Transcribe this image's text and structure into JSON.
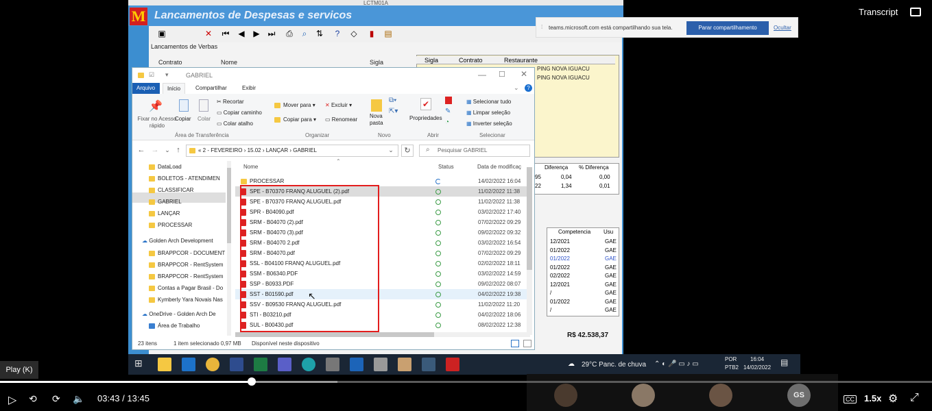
{
  "video": {
    "transcript_label": "Transcript",
    "play_tooltip": "Play (K)",
    "current_time": "03:43",
    "time_separator": "/",
    "duration": "13:45",
    "speed": "1.5x",
    "cc_label": "CC",
    "progress_fraction": 0.27
  },
  "share_banner": {
    "message": "teams.microsoft.com está compartilhando sua tela.",
    "stop_button": "Parar compartilhamento",
    "hide_link": "Ocultar"
  },
  "legacy_app": {
    "window_title": "LCTM01A",
    "header_title": "Lancamentos de Despesas e servicos",
    "section_label": "Lancamentos de Verbas",
    "columns": [
      "Contrato",
      "Nome",
      "Sigla"
    ],
    "right_grid_headers": [
      "Sigla",
      "Contrato",
      "Restaurante"
    ],
    "right_grid_rows": [
      "PING NOVA IGUACU",
      "PING NOVA IGUACU"
    ],
    "diff_headers": [
      "Diferença",
      "% Diferença"
    ],
    "diff_rows": [
      [
        "95",
        "0,04",
        "0,00"
      ],
      [
        "22",
        "1,34",
        "0,01"
      ]
    ],
    "competencia_header": "Competencia",
    "usu_header": "Usu",
    "competencia_rows": [
      [
        "12/2021",
        "GAE"
      ],
      [
        "01/2022",
        "GAE"
      ],
      [
        "01/2022",
        "GAE"
      ],
      [
        "01/2022",
        "GAE"
      ],
      [
        "02/2022",
        "GAE"
      ],
      [
        "12/2021",
        "GAE"
      ],
      [
        "/",
        "GAE"
      ],
      [
        "01/2022",
        "GAE"
      ],
      [
        "/",
        "GAE"
      ]
    ],
    "total": "R$ 42.538,37"
  },
  "explorer": {
    "title": "GABRIEL",
    "tabs": [
      "Arquivo",
      "Início",
      "Compartilhar",
      "Exibir"
    ],
    "ribbon": {
      "pin": "Fixar no Acesso rápido",
      "copy": "Copiar",
      "paste": "Colar",
      "cut": "Recortar",
      "copy_path": "Copiar caminho",
      "paste_shortcut": "Colar atalho",
      "group_clipboard": "Área de Transferência",
      "move_to": "Mover para",
      "copy_to": "Copiar para",
      "delete": "Excluir",
      "rename": "Renomear",
      "group_organize": "Organizar",
      "new_folder": "Nova pasta",
      "group_new": "Novo",
      "properties": "Propriedades",
      "group_open": "Abrir",
      "select_all": "Selecionar tudo",
      "select_none": "Limpar seleção",
      "invert_selection": "Inverter seleção",
      "group_select": "Selecionar"
    },
    "breadcrumb": [
      "2 - FEVEREIRO",
      "15.02",
      "LANÇAR",
      "GABRIEL"
    ],
    "search_placeholder": "Pesquisar GABRIEL",
    "left_pane": [
      "DataLoad",
      "BOLETOS - ATENDIMEN",
      "CLASSIFICAR",
      "GABRIEL",
      "LANÇAR",
      "PROCESSAR",
      "Golden Arch Development",
      "BRAPPCOR - DOCUMENT",
      "BRAPPCOR - RentSystem",
      "BRAPPCOR - RentSystem",
      "Contas a Pagar Brasil - Do",
      "Kymberly Yara Novais Nas",
      "OneDrive - Golden Arch De",
      "Área de Trabalho"
    ],
    "columns": [
      "Nome",
      "Status",
      "Data de modificaç"
    ],
    "files": [
      {
        "name": "PROCESSAR",
        "date": "14/02/2022 16:04",
        "type": "folder"
      },
      {
        "name": "SPE - B70370 FRANQ ALUGUEL (2).pdf",
        "date": "11/02/2022 11:38",
        "type": "pdf"
      },
      {
        "name": "SPE - B70370 FRANQ ALUGUEL.pdf",
        "date": "11/02/2022 11:38",
        "type": "pdf"
      },
      {
        "name": "SPR - B04090.pdf",
        "date": "03/02/2022 17:40",
        "type": "pdf"
      },
      {
        "name": "SRM - B04070 (2).pdf",
        "date": "07/02/2022 09:29",
        "type": "pdf"
      },
      {
        "name": "SRM - B04070 (3).pdf",
        "date": "09/02/2022 09:32",
        "type": "pdf"
      },
      {
        "name": "SRM - B04070 2.pdf",
        "date": "03/02/2022 16:54",
        "type": "pdf"
      },
      {
        "name": "SRM - B04070.pdf",
        "date": "07/02/2022 09:29",
        "type": "pdf"
      },
      {
        "name": "SSL - B04100 FRANQ ALUGUEL.pdf",
        "date": "02/02/2022 18:11",
        "type": "pdf"
      },
      {
        "name": "SSM - B06340.PDF",
        "date": "03/02/2022 14:59",
        "type": "pdf"
      },
      {
        "name": "SSP - B0933.PDF",
        "date": "09/02/2022 08:07",
        "type": "pdf"
      },
      {
        "name": "SST - B01590.pdf",
        "date": "04/02/2022 19:38",
        "type": "pdf"
      },
      {
        "name": "SSV - B09530 FRANQ ALUGUEL.pdf",
        "date": "11/02/2022 11:20",
        "type": "pdf"
      },
      {
        "name": "STI - B03210.pdf",
        "date": "04/02/2022 18:06",
        "type": "pdf"
      },
      {
        "name": "SUL - B00430.pdf",
        "date": "08/02/2022 12:38",
        "type": "pdf"
      }
    ],
    "status_bar": {
      "count": "23 itens",
      "selected": "1 item selecionado 0,97 MB",
      "availability": "Disponível neste dispositivo"
    }
  },
  "taskbar": {
    "weather": "29°C  Panc. de chuva",
    "lang": "POR",
    "lang2": "PTB2",
    "time": "16:04",
    "date": "14/02/2022"
  },
  "participants": {
    "initials": "GS"
  }
}
